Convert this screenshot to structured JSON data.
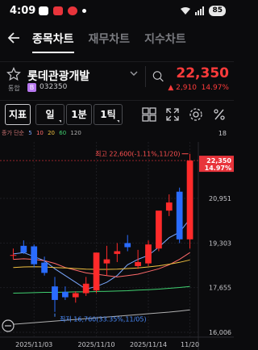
{
  "status": {
    "time": "4:09",
    "battery": "85"
  },
  "nav": {
    "tabs": [
      "종목차트",
      "재무차트",
      "지수차트"
    ],
    "active": 0
  },
  "stock": {
    "name": "롯데관광개발",
    "market": "통합",
    "badge": "B",
    "code": "032350",
    "price": "22,350",
    "change": "▲ 2,910",
    "change_pct": "14.97%"
  },
  "toolbar": {
    "indicator": "지표",
    "period": "일",
    "minute": "1분",
    "tick": "1틱"
  },
  "indicators": {
    "label": "종가 단순",
    "periods": [
      {
        "value": "5",
        "color": "#7aa8ff"
      },
      {
        "value": "10",
        "color": "#ff6a6a"
      },
      {
        "value": "20",
        "color": "#f0c040"
      },
      {
        "value": "60",
        "color": "#40d070"
      },
      {
        "value": "120",
        "color": "#b0b0b0"
      }
    ],
    "count": "18"
  },
  "chart_data": {
    "type": "candlestick",
    "y_ticks": [
      "20,951",
      "19,303",
      "17,655",
      "16,006"
    ],
    "price_tag": "22,350",
    "price_tag_pct": "14.97%",
    "ylim": [
      16006,
      22800
    ],
    "x_labels": [
      "2025/11/03",
      "2025/11/10",
      "2025/11/14",
      "11/20"
    ],
    "annotations": {
      "high": "최고 22,600(-1.11%,11/20)",
      "low": "최저 16,760(33.35%,11/05)"
    },
    "candles": [
      {
        "o": 18860,
        "h": 19100,
        "l": 18700,
        "c": 18860
      },
      {
        "o": 19200,
        "h": 19400,
        "l": 18900,
        "c": 18950
      },
      {
        "o": 19180,
        "h": 19250,
        "l": 18400,
        "c": 18520
      },
      {
        "o": 18580,
        "h": 18800,
        "l": 18100,
        "c": 18200
      },
      {
        "o": 17700,
        "h": 18050,
        "l": 16760,
        "c": 17200
      },
      {
        "o": 17500,
        "h": 17700,
        "l": 17200,
        "c": 17300
      },
      {
        "o": 17300,
        "h": 17520,
        "l": 17100,
        "c": 17450
      },
      {
        "o": 17450,
        "h": 18050,
        "l": 17350,
        "c": 17800
      },
      {
        "o": 17550,
        "h": 18400,
        "l": 17450,
        "c": 18950
      },
      {
        "o": 18550,
        "h": 19200,
        "l": 18100,
        "c": 18700
      },
      {
        "o": 18900,
        "h": 19300,
        "l": 18600,
        "c": 19000
      },
      {
        "o": 19300,
        "h": 19600,
        "l": 19000,
        "c": 19150
      },
      {
        "o": 18450,
        "h": 19050,
        "l": 18350,
        "c": 18600
      },
      {
        "o": 18550,
        "h": 19400,
        "l": 18450,
        "c": 19250
      },
      {
        "o": 19100,
        "h": 20100,
        "l": 19000,
        "c": 20500
      },
      {
        "o": 20500,
        "h": 21100,
        "l": 20300,
        "c": 20800
      },
      {
        "o": 21200,
        "h": 21350,
        "l": 19300,
        "c": 19440
      },
      {
        "o": 19440,
        "h": 22600,
        "l": 19100,
        "c": 22350
      }
    ],
    "ma_series": [
      {
        "name": "5",
        "color": "#7aa8ff",
        "values": [
          18900,
          18950,
          18800,
          18650,
          18350,
          18100,
          17850,
          17600,
          17700,
          17850,
          18100,
          18500,
          18700,
          18850,
          19150,
          19500,
          19700,
          20200
        ]
      },
      {
        "name": "10",
        "color": "#ff6a6a",
        "values": [
          18700,
          18720,
          18700,
          18650,
          18550,
          18400,
          18300,
          18200,
          18150,
          18100,
          18050,
          18100,
          18150,
          18250,
          18350,
          18500,
          18700,
          18950
        ]
      },
      {
        "name": "20",
        "color": "#f0c040",
        "values": [
          18400,
          18420,
          18430,
          18420,
          18400,
          18380,
          18360,
          18340,
          18330,
          18330,
          18340,
          18360,
          18380,
          18420,
          18460,
          18520,
          18590,
          18680
        ]
      },
      {
        "name": "60",
        "color": "#40d070",
        "values": [
          17450,
          17460,
          17470,
          17480,
          17480,
          17490,
          17500,
          17500,
          17510,
          17520,
          17530,
          17540,
          17560,
          17580,
          17600,
          17630,
          17660,
          17700
        ]
      },
      {
        "name": "120",
        "color": "#b0b0b0",
        "values": [
          16300,
          16330,
          16360,
          16390,
          16420,
          16450,
          16480,
          16510,
          16540,
          16570,
          16600,
          16630,
          16660,
          16690,
          16720,
          16750,
          16790,
          16830
        ]
      }
    ]
  }
}
